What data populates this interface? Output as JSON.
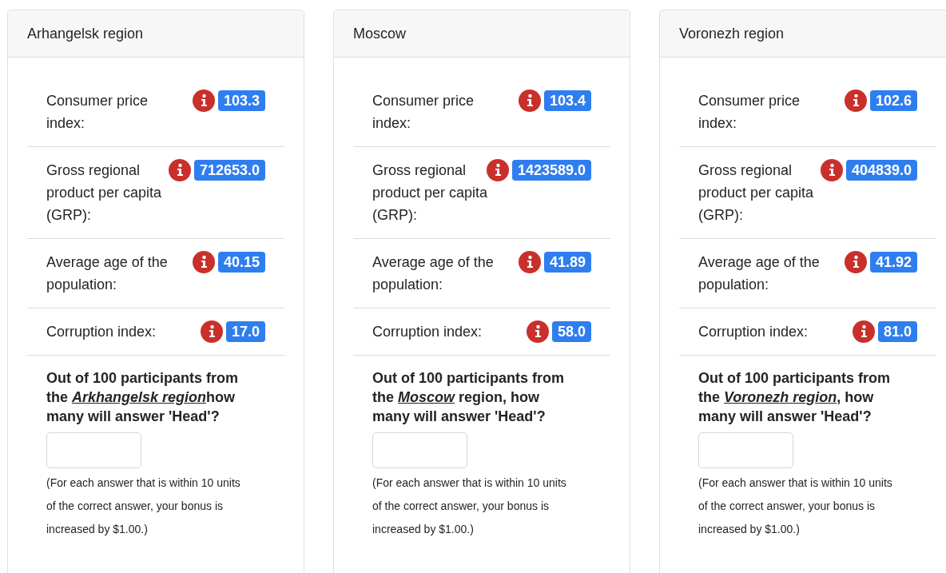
{
  "regions": [
    {
      "title": "Arhangelsk region",
      "metrics": [
        {
          "label": "Consumer price index:",
          "value": "103.3"
        },
        {
          "label": "Gross regional product per capita (GRP):",
          "value": "712653.0"
        },
        {
          "label": "Average age of the population:",
          "value": "40.15"
        },
        {
          "label": "Corruption index:",
          "value": "17.0"
        }
      ],
      "question": {
        "before": "Out of 100 participants from the ",
        "place": "Arkhangelsk region",
        "after": "how many will answer 'Head'?"
      },
      "note": "(For each answer that is within 10 units of the correct answer, your bonus is increased by $1.00.)"
    },
    {
      "title": "Moscow",
      "metrics": [
        {
          "label": "Consumer price index:",
          "value": "103.4"
        },
        {
          "label": "Gross regional product per capita (GRP):",
          "value": "1423589.0"
        },
        {
          "label": "Average age of the population:",
          "value": "41.89"
        },
        {
          "label": "Corruption index:",
          "value": "58.0"
        }
      ],
      "question": {
        "before": "Out of 100 participants from the ",
        "place": "Moscow",
        "after": " region, how many will answer 'Head'?"
      },
      "note": "(For each answer that is within 10 units of the correct answer, your bonus is increased by $1.00.)"
    },
    {
      "title": "Voronezh region",
      "metrics": [
        {
          "label": "Consumer price index:",
          "value": "102.6"
        },
        {
          "label": "Gross regional product per capita (GRP):",
          "value": "404839.0"
        },
        {
          "label": "Average age of the population:",
          "value": "41.92"
        },
        {
          "label": "Corruption index:",
          "value": "81.0"
        }
      ],
      "question": {
        "before": "Out of 100 participants from the ",
        "place": "Voronezh region",
        "after": ", how many will answer 'Head'?"
      },
      "note": "(For each answer that is within 10 units of the correct answer, your bonus is increased by $1.00.)"
    }
  ]
}
